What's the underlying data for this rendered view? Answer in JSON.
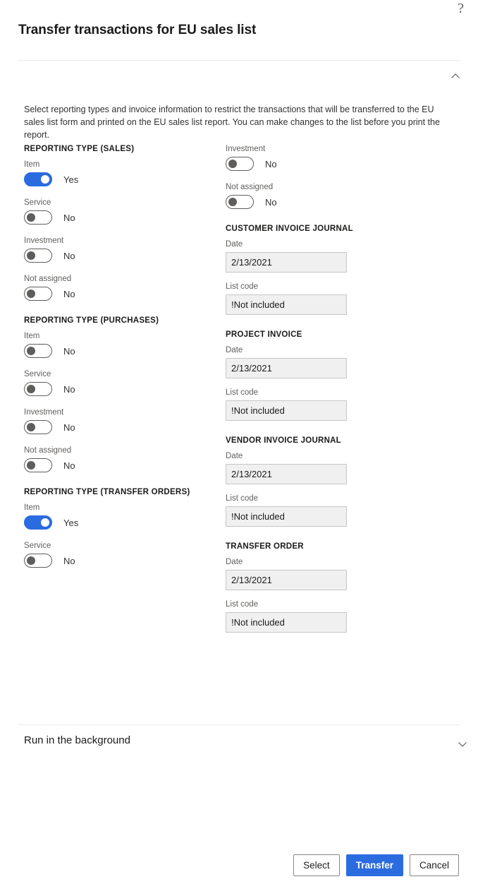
{
  "header": {
    "help_icon": "help-question-icon",
    "title": "Transfer transactions for EU sales list",
    "collapse_icon": "chevron-up-icon"
  },
  "intro": {
    "text": "Select reporting types and invoice information to restrict the transactions that will be transferred to the EU sales list form and printed on the EU sales list report. You can make changes to the list before you print the report."
  },
  "left_column": {
    "sales": {
      "heading": "REPORTING TYPE (SALES)",
      "fields": [
        {
          "label": "Item",
          "state": "Yes"
        },
        {
          "label": "Service",
          "state": "No"
        },
        {
          "label": "Investment",
          "state": "No"
        },
        {
          "label": "Not assigned",
          "state": "No"
        }
      ]
    },
    "purchases": {
      "heading": "REPORTING TYPE (PURCHASES)",
      "fields": [
        {
          "label": "Item",
          "state": "No"
        },
        {
          "label": "Service",
          "state": "No"
        },
        {
          "label": "Investment",
          "state": "No"
        },
        {
          "label": "Not assigned",
          "state": "No"
        }
      ]
    },
    "transfer_orders": {
      "heading": "REPORTING TYPE (TRANSFER ORDERS)",
      "fields": [
        {
          "label": "Item",
          "state": "Yes"
        },
        {
          "label": "Service",
          "state": "No"
        }
      ]
    }
  },
  "right_column": {
    "top_toggles": [
      {
        "label": "Investment",
        "state": "No"
      },
      {
        "label": "Not assigned",
        "state": "No"
      }
    ],
    "customer_invoice_journal": {
      "heading": "CUSTOMER INVOICE JOURNAL",
      "date_label": "Date",
      "date_value": "2/13/2021",
      "list_code_label": "List code",
      "list_code_value": "!Not included"
    },
    "project_invoice": {
      "heading": "PROJECT INVOICE",
      "date_label": "Date",
      "date_value": "2/13/2021",
      "list_code_label": "List code",
      "list_code_value": "!Not included"
    },
    "vendor_invoice_journal": {
      "heading": "VENDOR INVOICE JOURNAL",
      "date_label": "Date",
      "date_value": "2/13/2021",
      "list_code_label": "List code",
      "list_code_value": "!Not included"
    },
    "transfer_order": {
      "heading": "TRANSFER ORDER",
      "date_label": "Date",
      "date_value": "2/13/2021",
      "list_code_label": "List code",
      "list_code_value": "!Not included"
    }
  },
  "background_section": {
    "title": "Run in the background",
    "expand_icon": "chevron-down-icon"
  },
  "footer": {
    "select_label": "Select",
    "transfer_label": "Transfer",
    "cancel_label": "Cancel"
  },
  "colors": {
    "accent": "#2b6be0",
    "text": "#1b1a19",
    "muted_text": "#605e5c",
    "input_bg": "#f0f0f0",
    "border": "#c8c6c4"
  }
}
